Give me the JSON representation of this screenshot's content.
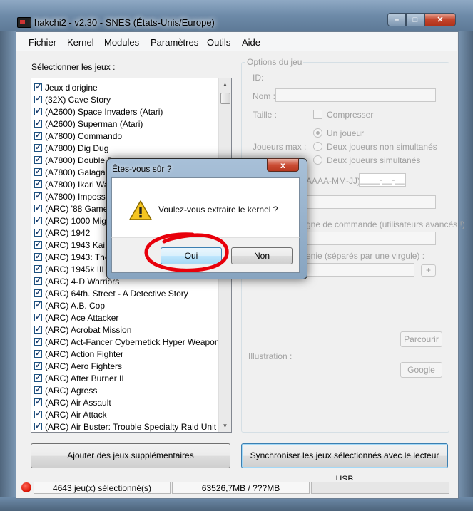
{
  "window": {
    "title": "hakchi2 - v2.30 - SNES (États-Unis/Europe)"
  },
  "menu": [
    "Fichier",
    "Kernel",
    "Modules",
    "Paramètres",
    "Outils",
    "Aide"
  ],
  "list": {
    "label": "Sélectionner les jeux :",
    "games": [
      "Jeux d'origine",
      "(32X) Cave Story",
      "(A2600) Space Invaders (Atari)",
      "(A2600) Superman (Atari)",
      "(A7800) Commando",
      "(A7800) Dig Dug",
      "(A7800) Double Dragon",
      "(A7800) Galaga",
      "(A7800) Ikari Warriors",
      "(A7800) Impossible Mission",
      "(ARC) '88 Games",
      "(ARC) 1000 Miglia",
      "(ARC) 1942",
      "(ARC) 1943 Kai",
      "(ARC) 1943: The Battle of Midway",
      "(ARC) 1945k III",
      "(ARC) 4-D Warriors",
      "(ARC) 64th. Street - A Detective Story",
      "(ARC) A.B. Cop",
      "(ARC) Ace Attacker",
      "(ARC) Acrobat Mission",
      "(ARC) Act-Fancer Cybernetick Hyper Weapon",
      "(ARC) Action Fighter",
      "(ARC) Aero Fighters",
      "(ARC) After Burner II",
      "(ARC) Agress",
      "(ARC) Air Assault",
      "(ARC) Air Attack",
      "(ARC) Air Buster: Trouble Specialty Raid Unit"
    ]
  },
  "options": {
    "legend": "Options du jeu",
    "id_label": "ID:",
    "name_label": "Nom :",
    "size_label": "Taille :",
    "compress_label": "Compresser",
    "players_label": "Joueurs max :",
    "radio_one": "Un joueur",
    "radio_two_alt": "Deux joueurs non simultanés",
    "radio_two_sim": "Deux joueurs simultanés",
    "date_label": "AAAA-MM-JJ) :",
    "date_value": "____-__-__",
    "cmdline_label": "gne de commande (utilisateurs avancés !)",
    "genre_label": "enie (séparés par une virgule) :",
    "plus": "+",
    "illustration_label": "Illustration :",
    "browse": "Parcourir",
    "google": "Google"
  },
  "buttons": {
    "add_games": "Ajouter des jeux supplémentaires",
    "sync": "Synchroniser les jeux sélectionnés avec le lecteur USB"
  },
  "status": {
    "selected": "4643 jeu(x) sélectionné(s)",
    "size": "63526,7MB / ???MB"
  },
  "dialog": {
    "title": "Êtes-vous sûr ?",
    "close": "x",
    "message": "Voulez-vous extraire le kernel ?",
    "yes": "Oui",
    "no": "Non"
  },
  "colors": {
    "annotation": "#e8000b",
    "accent": "#3c7fb1"
  },
  "icons": {
    "dialog": "warning-icon"
  }
}
